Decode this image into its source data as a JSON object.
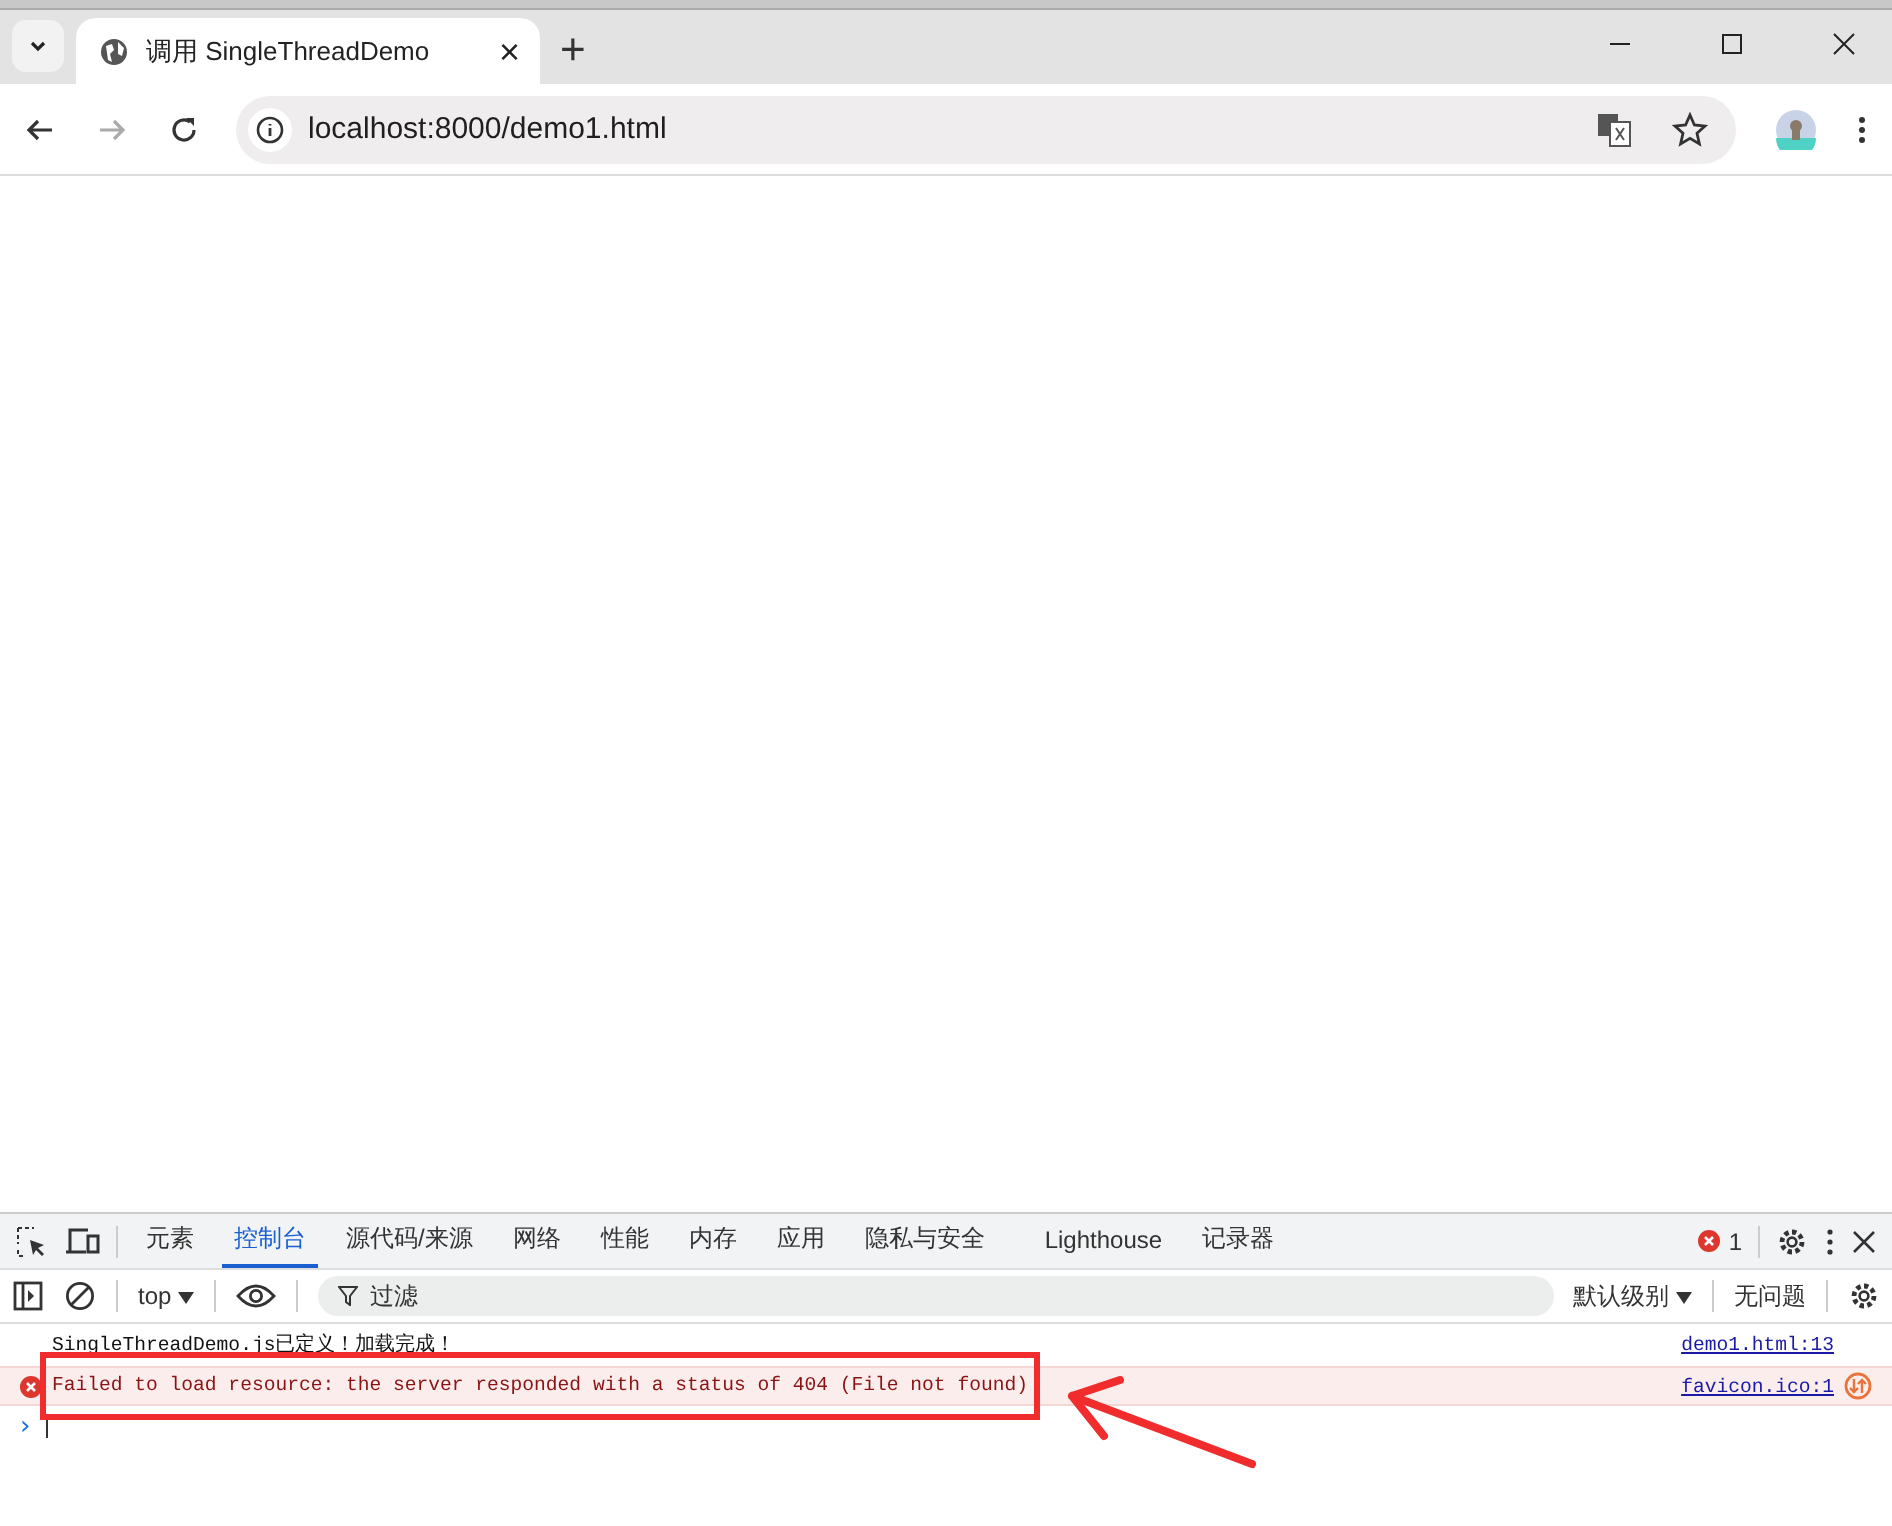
{
  "browser_tab": {
    "title": "调用 SingleThreadDemo",
    "close": "×",
    "new_tab": "+"
  },
  "address_bar": {
    "url": "localhost:8000/demo1.html"
  },
  "devtools": {
    "tabs": [
      {
        "label": "元素",
        "selected": false
      },
      {
        "label": "控制台",
        "selected": true
      },
      {
        "label": "源代码/来源",
        "selected": false
      },
      {
        "label": "网络",
        "selected": false
      },
      {
        "label": "性能",
        "selected": false
      },
      {
        "label": "内存",
        "selected": false
      },
      {
        "label": "应用",
        "selected": false
      },
      {
        "label": "隐私与安全",
        "selected": false
      },
      {
        "label": "Lighthouse",
        "selected": false
      },
      {
        "label": "记录器",
        "selected": false
      }
    ],
    "error_count": "1",
    "context": "top",
    "filter_placeholder": "过滤",
    "levels": "默认级别",
    "issues": "无问题",
    "messages": [
      {
        "kind": "info",
        "text": "SingleThreadDemo.js已定义！加载完成！",
        "source": "demo1.html:13",
        "highlighted": false
      },
      {
        "kind": "error",
        "text": "Failed to load resource: the server responded with a status of 404 (File not found)",
        "source": "favicon.ico:1",
        "highlighted": true
      }
    ],
    "prompt": "›"
  }
}
